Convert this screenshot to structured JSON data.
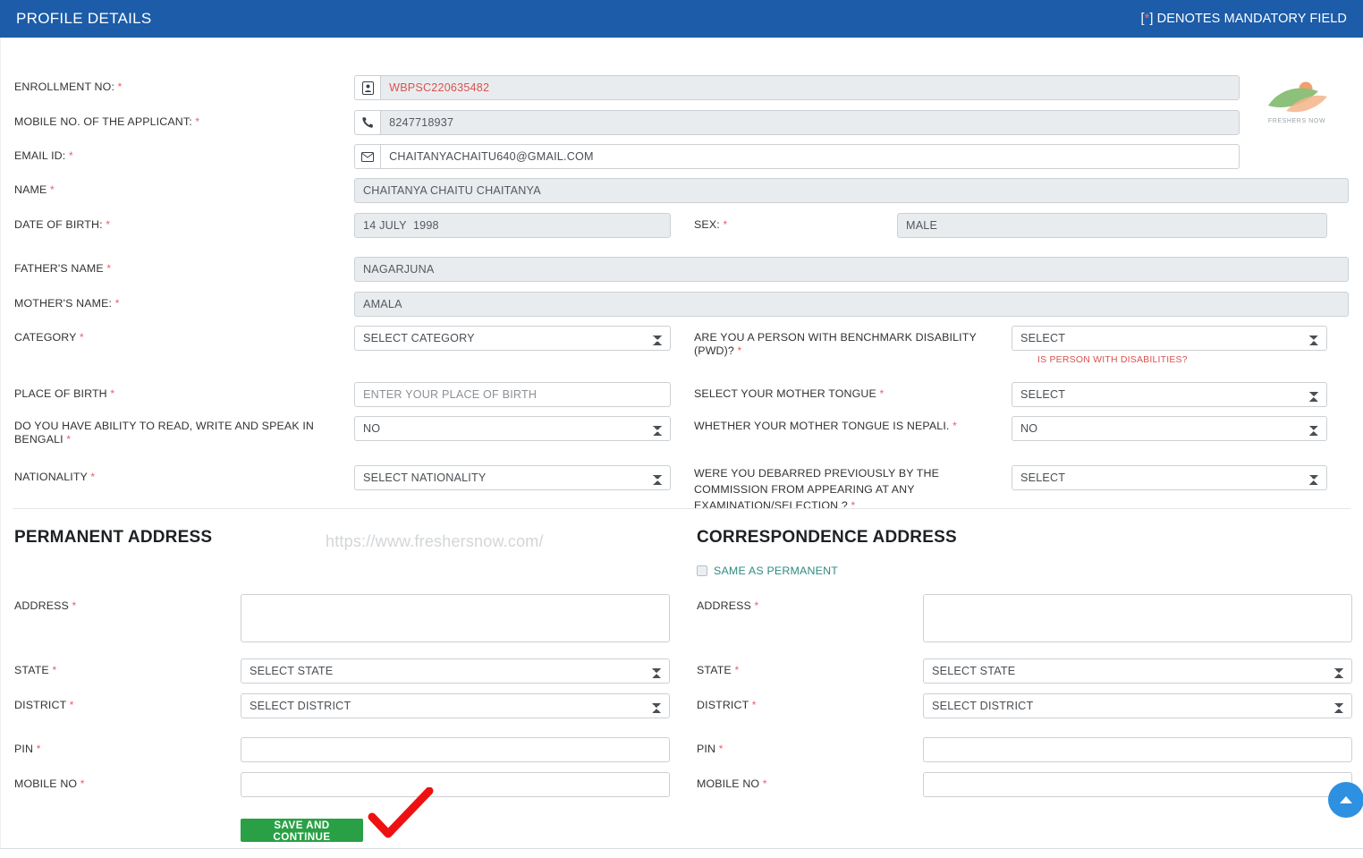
{
  "header": {
    "title": "PROFILE DETAILS",
    "mandatory_note_prefix": "[",
    "mandatory_note_star": "*",
    "mandatory_note_suffix": "] DENOTES MANDATORY FIELD",
    "bg_color": "#1c5ca8"
  },
  "logo": {
    "text": "FRESHERS NOW"
  },
  "watermark": {
    "url": "https://www.freshersnow.com/"
  },
  "profile": {
    "enrollment": {
      "label": "ENROLLMENT NO:",
      "required": "*",
      "value": "WBPSC220635482",
      "icon": "id-card-icon"
    },
    "mobile": {
      "label": "MOBILE NO. OF THE APPLICANT:",
      "required": "*",
      "value": "8247718937",
      "icon": "phone-icon"
    },
    "email": {
      "label": "EMAIL ID:",
      "required": "*",
      "value": "CHAITANYACHAITU640@GMAIL.COM",
      "icon": "envelope-icon"
    },
    "name": {
      "label": "NAME",
      "required": "*",
      "value": "CHAITANYA CHAITU CHAITANYA"
    },
    "dob": {
      "label": "DATE OF BIRTH:",
      "required": "*",
      "value": "14 JULY  1998"
    },
    "sex": {
      "label": "SEX:",
      "required": "*",
      "value": "MALE"
    },
    "father": {
      "label": "FATHER'S NAME",
      "required": "*",
      "value": "NAGARJUNA"
    },
    "mother": {
      "label": "MOTHER'S NAME:",
      "required": "*",
      "value": "AMALA"
    },
    "category": {
      "label": "CATEGORY",
      "required": "*",
      "value": "SELECT CATEGORY"
    },
    "pwd": {
      "label": "ARE YOU A PERSON WITH BENCHMARK DISABILITY (PWD)?",
      "required": "*",
      "value": "SELECT",
      "note": "IS PERSON WITH DISABILITIES?"
    },
    "place_of_birth": {
      "label": "PLACE OF BIRTH",
      "required": "*",
      "value": "",
      "placeholder": "ENTER YOUR PLACE OF BIRTH"
    },
    "mother_tongue": {
      "label": "SELECT YOUR MOTHER TONGUE",
      "required": "*",
      "value": "SELECT"
    },
    "bengali": {
      "label": "DO YOU HAVE ABILITY TO READ, WRITE AND SPEAK IN BENGALI",
      "required": "*",
      "value": "NO"
    },
    "nepali": {
      "label": "WHETHER YOUR MOTHER TONGUE IS NEPALI.",
      "required": "*",
      "value": "NO"
    },
    "nationality": {
      "label": "NATIONALITY",
      "required": "*",
      "value": "SELECT NATIONALITY"
    },
    "debarred": {
      "label": "WERE YOU DEBARRED PREVIOUSLY BY THE COMMISSION FROM APPEARING AT ANY EXAMINATION/SELECTION ?",
      "required": "*",
      "value": "SELECT"
    }
  },
  "permanent": {
    "heading": "PERMANENT ADDRESS",
    "address": {
      "label": "ADDRESS",
      "required": "*",
      "value": ""
    },
    "state": {
      "label": "STATE",
      "required": "*",
      "value": "SELECT STATE"
    },
    "district": {
      "label": "DISTRICT",
      "required": "*",
      "value": "SELECT DISTRICT"
    },
    "pin": {
      "label": "PIN",
      "required": "*",
      "value": ""
    },
    "mobile": {
      "label": "MOBILE NO",
      "required": "*",
      "value": ""
    }
  },
  "correspondence": {
    "heading": "CORRESPONDENCE ADDRESS",
    "same_as_permanent": "SAME AS PERMANENT",
    "address": {
      "label": "ADDRESS",
      "required": "*",
      "value": ""
    },
    "state": {
      "label": "STATE",
      "required": "*",
      "value": "SELECT STATE"
    },
    "district": {
      "label": "DISTRICT",
      "required": "*",
      "value": "SELECT DISTRICT"
    },
    "pin": {
      "label": "PIN",
      "required": "*",
      "value": ""
    },
    "mobile": {
      "label": "MOBILE NO",
      "required": "*",
      "value": ""
    }
  },
  "actions": {
    "save_and_continue": "SAVE AND CONTINUE"
  },
  "colors": {
    "header_blue": "#1c5ca8",
    "save_green": "#2aa046",
    "required_red": "#e8606a",
    "link_teal": "#2e8b84",
    "scroll_blue": "#2e90e0"
  }
}
